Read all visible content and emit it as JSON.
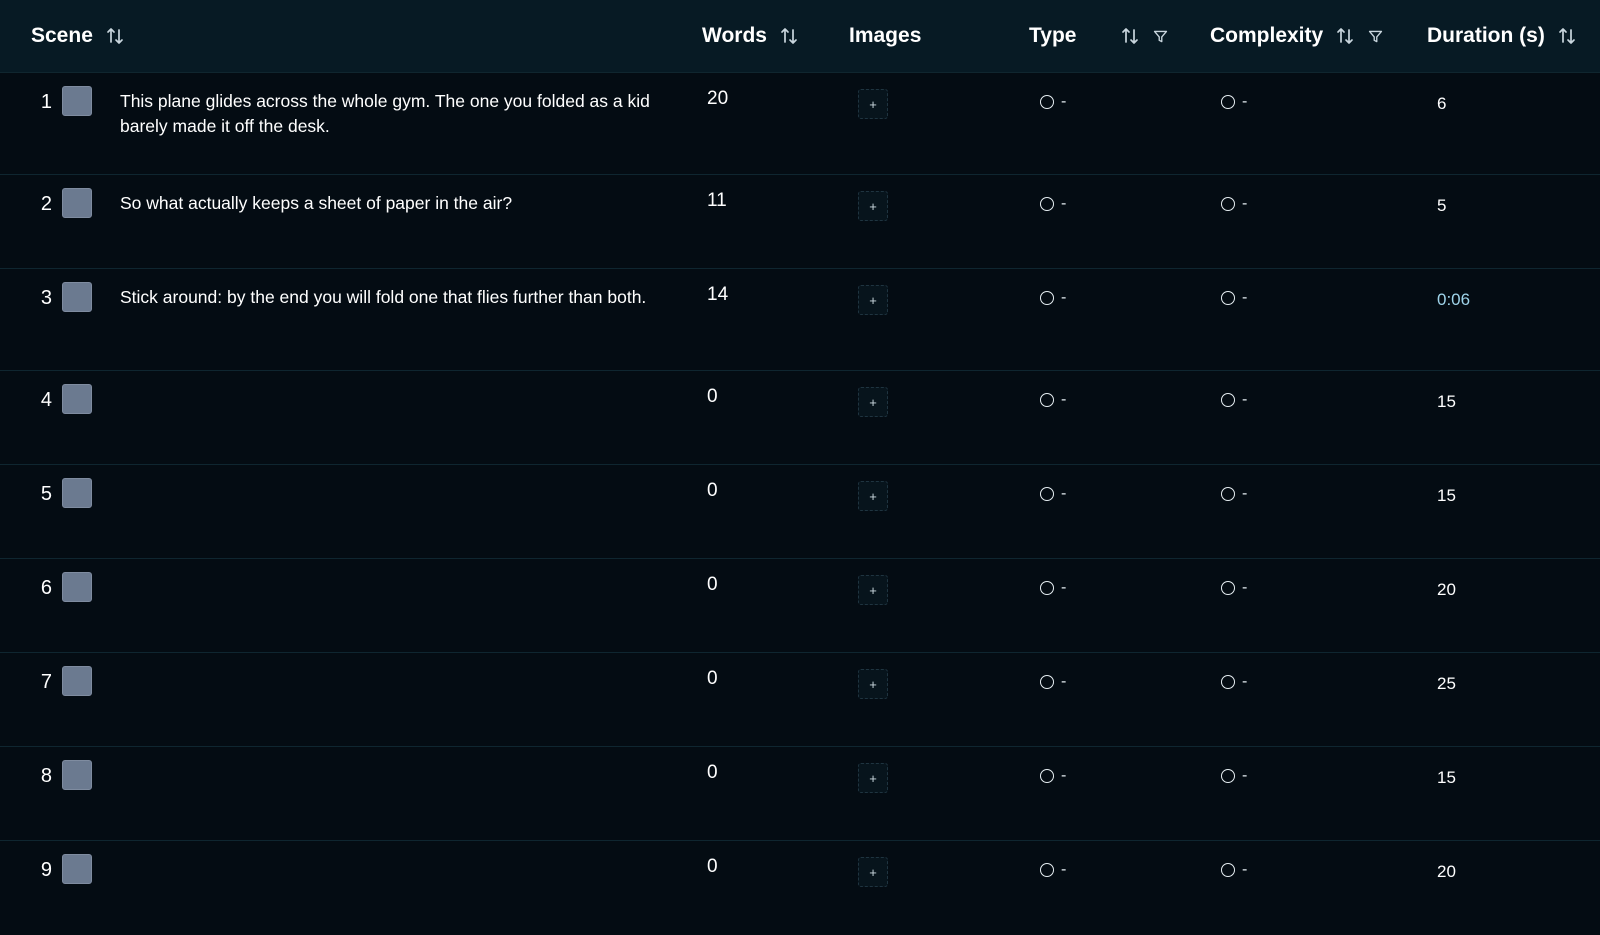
{
  "header": {
    "scene": "Scene",
    "words": "Words",
    "images": "Images",
    "type": "Type",
    "complexity": "Complexity",
    "duration": "Duration (s)"
  },
  "rows": [
    {
      "num": "1",
      "text": "This plane glides across the whole gym. The one you folded as a kid barely made it off the desk.",
      "words": "20",
      "add": "+",
      "type": "-",
      "complexity": "-",
      "duration": "6"
    },
    {
      "num": "2",
      "text": "So what actually keeps a sheet of paper in the air?",
      "words": "11",
      "add": "+",
      "type": "-",
      "complexity": "-",
      "duration": "5"
    },
    {
      "num": "3",
      "text": "Stick around: by the end you will fold one that flies further than both.",
      "words": "14",
      "add": "+",
      "type": "-",
      "complexity": "-",
      "duration": "0:06"
    },
    {
      "num": "4",
      "text": "",
      "words": "0",
      "add": "+",
      "type": "-",
      "complexity": "-",
      "duration": "15"
    },
    {
      "num": "5",
      "text": "",
      "words": "0",
      "add": "+",
      "type": "-",
      "complexity": "-",
      "duration": "15"
    },
    {
      "num": "6",
      "text": "",
      "words": "0",
      "add": "+",
      "type": "-",
      "complexity": "-",
      "duration": "20"
    },
    {
      "num": "7",
      "text": "",
      "words": "0",
      "add": "+",
      "type": "-",
      "complexity": "-",
      "duration": "25"
    },
    {
      "num": "8",
      "text": "",
      "words": "0",
      "add": "+",
      "type": "-",
      "complexity": "-",
      "duration": "15"
    },
    {
      "num": "9",
      "text": "",
      "words": "0",
      "add": "+",
      "type": "-",
      "complexity": "-",
      "duration": "20"
    }
  ]
}
